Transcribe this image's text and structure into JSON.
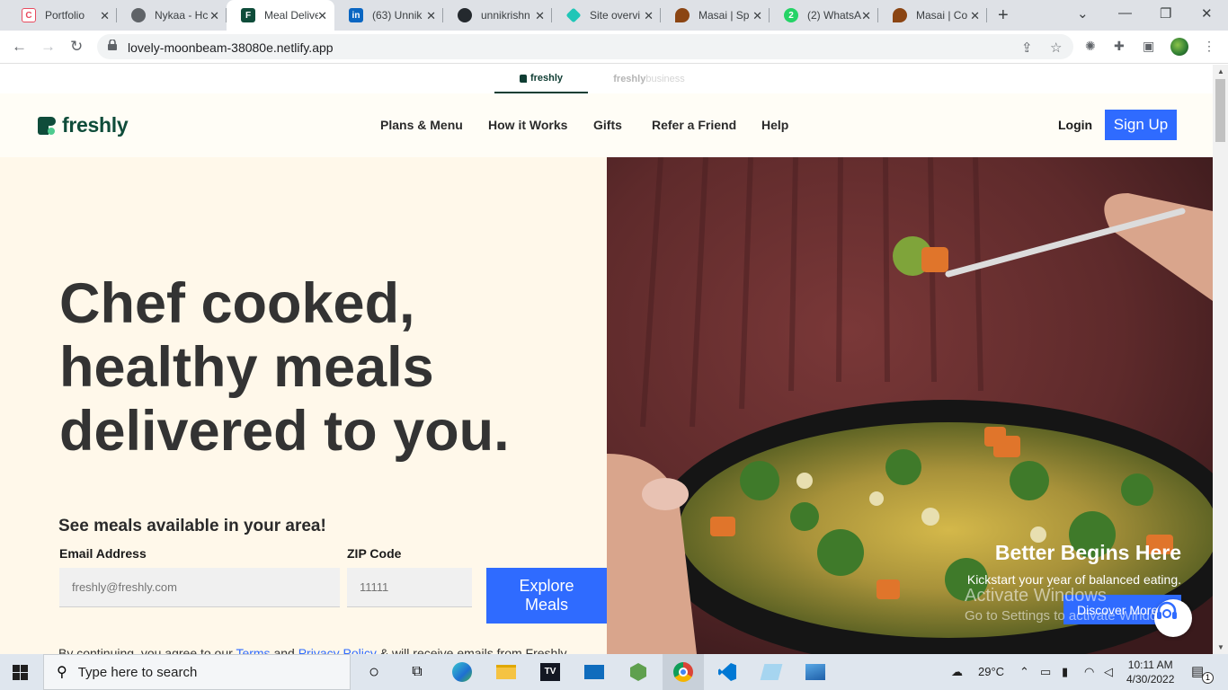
{
  "browser": {
    "tabs": [
      {
        "title": "Portfolio",
        "icon": "portfolio-icon",
        "color": "#e84a5f"
      },
      {
        "title": "Nykaa - Hc",
        "icon": "globe-icon",
        "color": "#5f6368"
      },
      {
        "title": "Meal Delive",
        "icon": "freshly-icon",
        "color": "#0f4c3a",
        "active": true
      },
      {
        "title": "(63) Unnik",
        "icon": "linkedin-icon",
        "color": "#0a66c2"
      },
      {
        "title": "unnikrishn",
        "icon": "github-icon",
        "color": "#24292e"
      },
      {
        "title": "Site overvi",
        "icon": "netlify-icon",
        "color": "#20c6b7"
      },
      {
        "title": "Masai | Sp",
        "icon": "masai-icon",
        "color": "#8b4513"
      },
      {
        "title": "(2) WhatsA",
        "icon": "whatsapp-icon",
        "color": "#25d366"
      },
      {
        "title": "Masai | Co",
        "icon": "masai-icon",
        "color": "#8b4513"
      }
    ],
    "url": "lovely-moonbeam-38080e.netlify.app"
  },
  "brand_switcher": {
    "active": "freshly",
    "inactive_1": "freshly",
    "inactive_2": "business"
  },
  "header": {
    "logo": "freshly",
    "nav": [
      "Plans & Menu",
      "How it Works",
      "Gifts",
      "Refer a Friend",
      "Help"
    ],
    "login": "Login",
    "signup": "Sign Up"
  },
  "hero": {
    "headline": "Chef cooked, healthy meals delivered to you.",
    "subhead": "See meals available in your area!",
    "email_label": "Email Address",
    "email_placeholder": "freshly@freshly.com",
    "zip_label": "ZIP Code",
    "zip_placeholder": "11111",
    "cta": "Explore Meals",
    "terms_prefix": "By continuing, you agree to our ",
    "terms_link": "Terms",
    "terms_and": " and ",
    "privacy_link": "Privacy Policy",
    "terms_suffix": " & will receive emails from Freshly."
  },
  "promo": {
    "title": "Better Begins Here",
    "subtitle": "Kickstart your year of balanced eating.",
    "button": "Discover More"
  },
  "watermark": {
    "line1": "Activate Windows",
    "line2": "Go to Settings to activate Windows."
  },
  "taskbar": {
    "search_placeholder": "Type here to search",
    "weather": "29°C",
    "time": "10:11 AM",
    "date": "4/30/2022",
    "notifications": "1"
  },
  "colors": {
    "brand_green": "#0f4c3a",
    "accent_blue": "#2f6bff",
    "hero_bg": "#fff8ea"
  }
}
